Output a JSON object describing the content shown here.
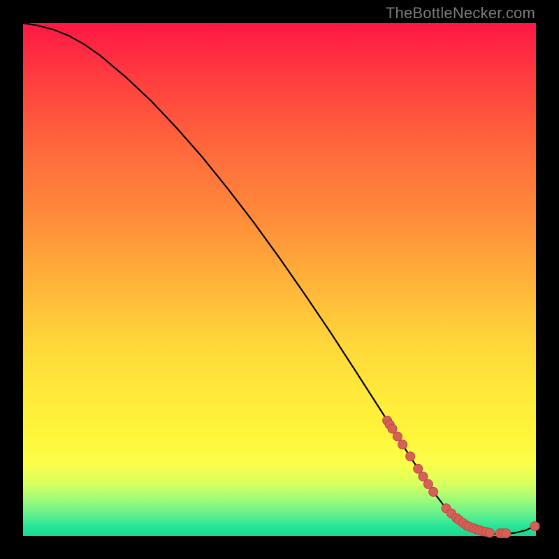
{
  "watermark": "TheBottleNecker.com",
  "colors": {
    "frame": "#000000",
    "curve": "#000000",
    "marker_fill": "#d66057",
    "marker_stroke": "#b94a42"
  },
  "chart_data": {
    "type": "line",
    "title": "",
    "xlabel": "",
    "ylabel": "",
    "xlim": [
      0,
      100
    ],
    "ylim": [
      0,
      100
    ],
    "x": [
      0,
      3,
      6,
      9,
      12,
      15,
      20,
      25,
      30,
      35,
      40,
      45,
      50,
      55,
      60,
      65,
      70,
      72,
      75,
      78,
      80,
      82,
      84,
      86,
      88,
      90,
      92,
      94,
      96,
      98,
      100
    ],
    "y": [
      100,
      99.5,
      98.7,
      97.5,
      95.8,
      93.7,
      89.5,
      84.8,
      79.5,
      73.8,
      67.6,
      61.1,
      54.2,
      47.0,
      39.6,
      31.9,
      24.1,
      20.9,
      16.2,
      11.6,
      8.6,
      6.0,
      3.8,
      2.2,
      1.2,
      0.6,
      0.4,
      0.4,
      0.6,
      1.1,
      2.0
    ],
    "markers_x": [
      71.0,
      71.5,
      72.0,
      73.0,
      74.0,
      75.5,
      77.0,
      78.0,
      79.0,
      80.0,
      82.5,
      83.5,
      84.5,
      85.0,
      85.8,
      86.5,
      87.0,
      87.8,
      88.4,
      89.0,
      89.6,
      90.3,
      91.0,
      93.0,
      93.6,
      94.2,
      99.8
    ],
    "markers_y": [
      22.5,
      21.7,
      20.9,
      19.4,
      17.8,
      15.5,
      13.1,
      11.6,
      10.1,
      8.6,
      5.4,
      4.4,
      3.5,
      3.1,
      2.5,
      2.0,
      1.8,
      1.5,
      1.3,
      1.1,
      0.9,
      0.8,
      0.6,
      0.5,
      0.5,
      0.5,
      1.9
    ]
  }
}
